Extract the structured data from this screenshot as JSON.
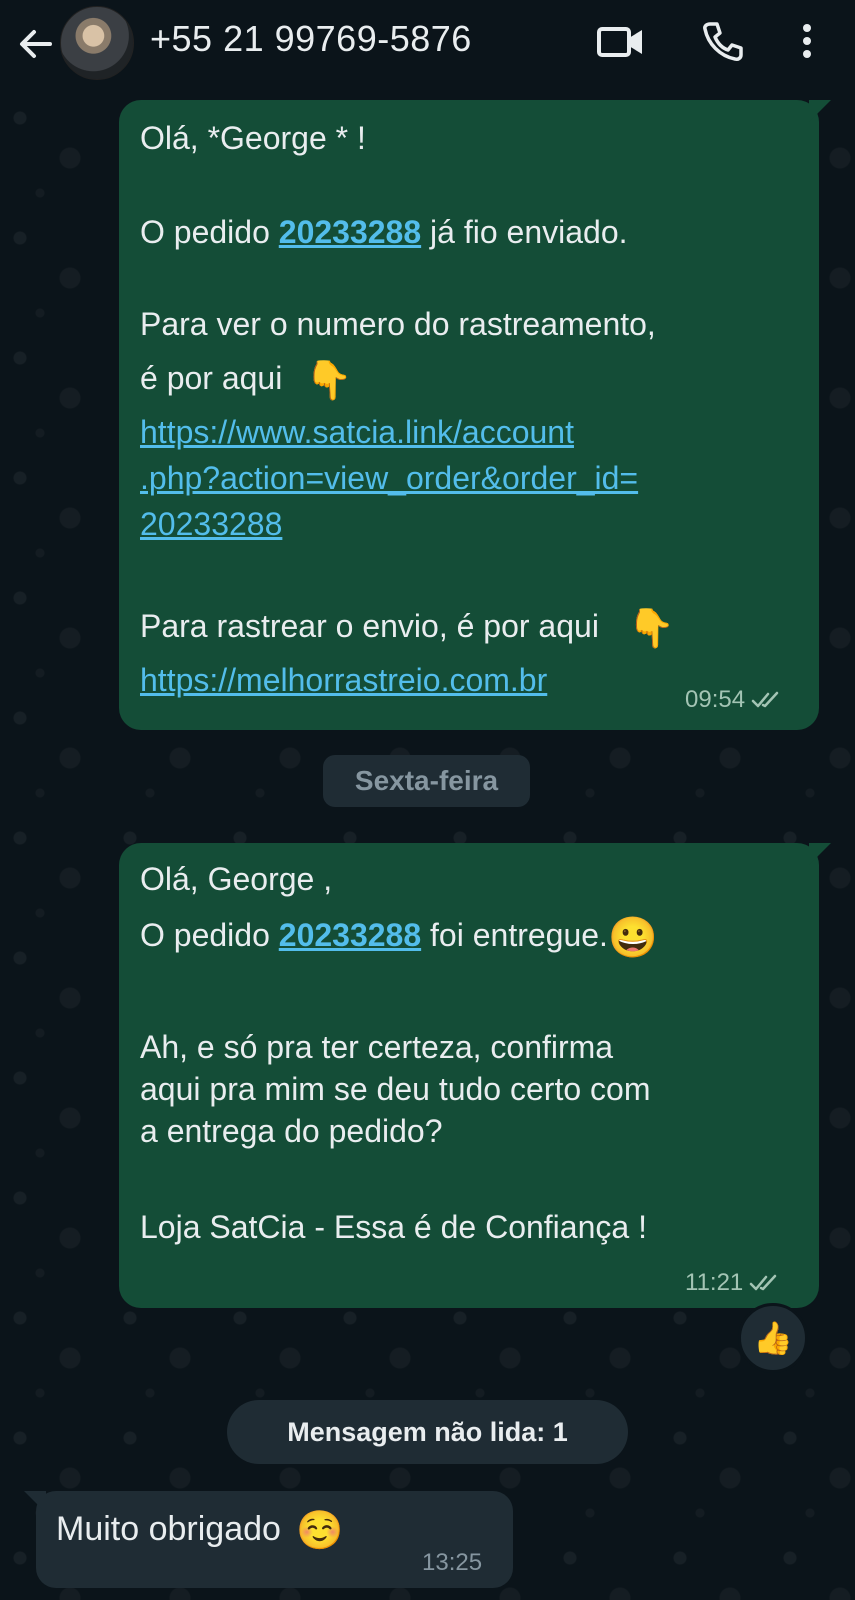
{
  "header": {
    "contact": "+55 21 99769-5876",
    "icons": [
      "back-arrow-icon",
      "video-call-icon",
      "phone-icon",
      "more-vert-icon"
    ]
  },
  "messages": [
    {
      "greeting": "Olá, *George * !",
      "order_prefix": "O pedido ",
      "order_number": "20233288",
      "order_suffix": " já fio enviado.",
      "tracking_line1": "Para ver o numero do rastreamento,",
      "tracking_line2": "é por aqui",
      "tracking_emoji": "👇",
      "link1_line1": "https://www.satcia.link/account",
      "link1_line2": ".php?action=view_order&order_id=",
      "link1_line3": "20233288",
      "track_ship_text": "Para rastrear o envio, é por aqui",
      "track_ship_emoji": "👇",
      "link2": "https://melhorrastreio.com.br",
      "time": "09:54",
      "status": "read-double-check"
    },
    {
      "greeting": "Olá, George ,",
      "order_prefix": "O pedido ",
      "order_number": "20233288",
      "order_suffix": " foi entregue.",
      "order_emoji": "😀",
      "confirm_line1": "Ah, e só pra ter certeza, confirma",
      "confirm_line2": "aqui pra mim se deu tudo certo com",
      "confirm_line3": "a entrega do pedido?",
      "signature": "Loja SatCia - Essa é de Confiança !",
      "time": "11:21",
      "status": "read-double-check",
      "reaction": "👍"
    },
    {
      "text": "Muito obrigado",
      "emoji": "☺️",
      "time": "13:25"
    }
  ],
  "date_divider": "Sexta-feira",
  "unread_divider": "Mensagem não lida: 1",
  "colors": {
    "background": "#0b141a",
    "outgoing_bubble": "#144d37",
    "incoming_bubble": "#1f2c34",
    "link": "#53bdeb"
  }
}
